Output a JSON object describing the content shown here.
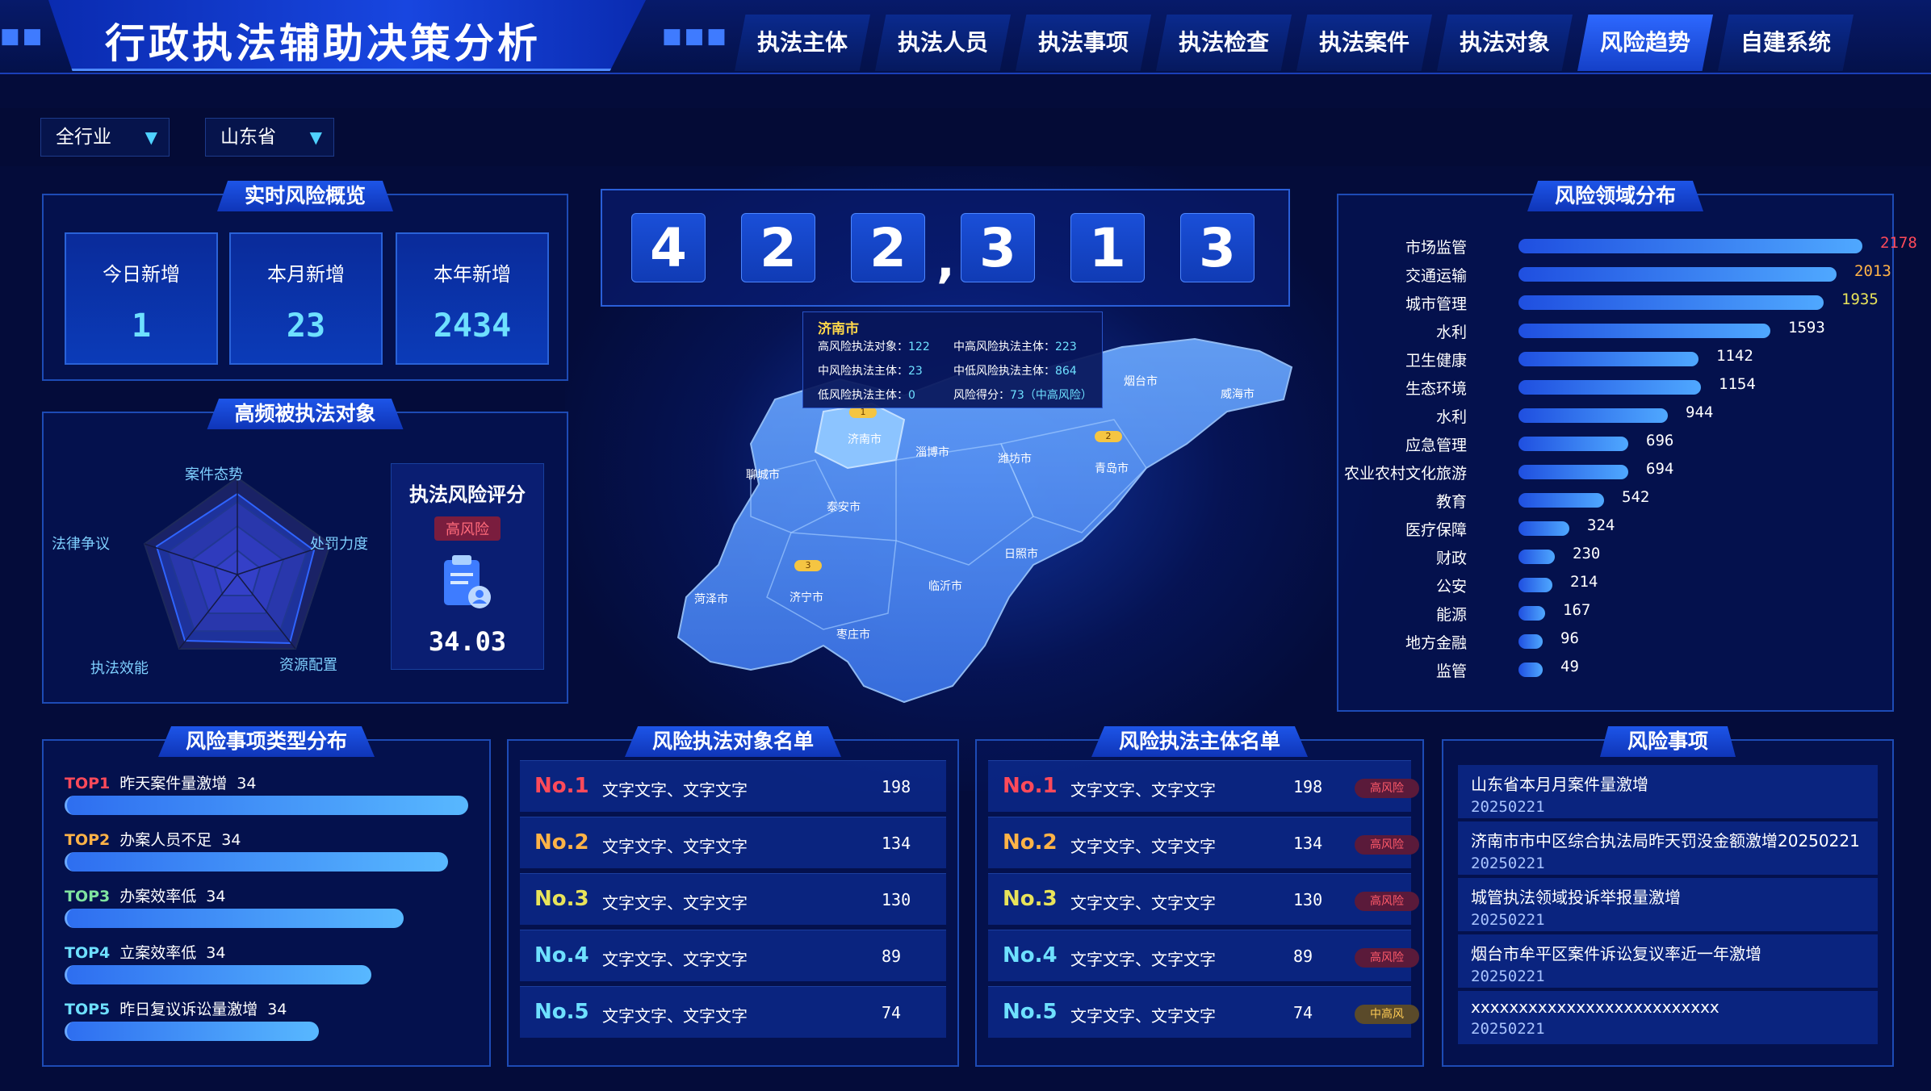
{
  "header": {
    "title": "行政执法辅助决策分析",
    "nav": [
      "执法主体",
      "执法人员",
      "执法事项",
      "执法检查",
      "执法案件",
      "执法对象",
      "风险趋势",
      "自建系统"
    ],
    "active_nav": "风险趋势"
  },
  "filters": {
    "industry": "全行业",
    "region": "山东省"
  },
  "overview": {
    "title": "实时风险概览",
    "stats": [
      {
        "label": "今日新增",
        "value": "1"
      },
      {
        "label": "本月新增",
        "value": "23"
      },
      {
        "label": "本年新增",
        "value": "2434"
      }
    ]
  },
  "radar": {
    "title": "高频被执法对象",
    "axes": [
      "案件态势",
      "处罚力度",
      "资源配置",
      "执法效能",
      "法律争议"
    ],
    "score_title": "执法风险评分",
    "score_level": "高风险",
    "score_value": "34.03"
  },
  "counter": {
    "digits": [
      "4",
      "2",
      "2",
      "3",
      "1",
      "3"
    ],
    "separator": ","
  },
  "map": {
    "tooltip": {
      "city": "济南市",
      "lines": [
        {
          "label": "高风险执法对象：",
          "value": "122"
        },
        {
          "label": "中高风险执法主体：",
          "value": "223"
        },
        {
          "label": "中风险执法主体：",
          "value": "23"
        },
        {
          "label": "中低风险执法主体：",
          "value": "864"
        },
        {
          "label": "低风险执法主体：",
          "value": "0"
        },
        {
          "label": "风险得分：",
          "value": "73（中高风险）"
        }
      ]
    },
    "cities": [
      "济南市",
      "淄博市",
      "潍坊市",
      "烟台市",
      "威海市",
      "青岛市",
      "聊城市",
      "泰安市",
      "日照市",
      "临沂市",
      "济宁市",
      "菏泽市",
      "枣庄市"
    ],
    "pins": [
      "1",
      "2",
      "3"
    ]
  },
  "risk_domain": {
    "title": "风险领域分布",
    "items": [
      {
        "label": "市场监管",
        "value": 2178,
        "color": "#ff4a5a"
      },
      {
        "label": "交通运输",
        "value": 2013,
        "color": "#ffb347"
      },
      {
        "label": "城市管理",
        "value": 1935,
        "color": "#e8e35a"
      },
      {
        "label": "水利",
        "value": 1593,
        "color": "#ffffff"
      },
      {
        "label": "卫生健康",
        "value": 1142,
        "color": "#ffffff"
      },
      {
        "label": "生态环境",
        "value": 1154,
        "color": "#ffffff"
      },
      {
        "label": "水利",
        "value": 944,
        "color": "#ffffff"
      },
      {
        "label": "应急管理",
        "value": 696,
        "color": "#ffffff"
      },
      {
        "label": "农业农村文化旅游",
        "value": 694,
        "color": "#ffffff"
      },
      {
        "label": "教育",
        "value": 542,
        "color": "#ffffff"
      },
      {
        "label": "医疗保障",
        "value": 324,
        "color": "#ffffff"
      },
      {
        "label": "财政",
        "value": 230,
        "color": "#ffffff"
      },
      {
        "label": "公安",
        "value": 214,
        "color": "#ffffff"
      },
      {
        "label": "能源",
        "value": 167,
        "color": "#ffffff"
      },
      {
        "label": "地方金融",
        "value": 96,
        "color": "#ffffff"
      },
      {
        "label": "监管",
        "value": 49,
        "color": "#ffffff"
      }
    ]
  },
  "risk_type": {
    "title": "风险事项类型分布",
    "items": [
      {
        "rank": "TOP1",
        "label": "昨天案件量激增",
        "value": "34",
        "color": "#ff4a5a",
        "level": 1.0
      },
      {
        "rank": "TOP2",
        "label": "办案人员不足",
        "value": "34",
        "color": "#ffb347",
        "level": 0.95
      },
      {
        "rank": "TOP3",
        "label": "办案效率低",
        "value": "34",
        "color": "#7fe3a0",
        "level": 0.84
      },
      {
        "rank": "TOP4",
        "label": "立案效率低",
        "value": "34",
        "color": "#6ee0ff",
        "level": 0.76
      },
      {
        "rank": "TOP5",
        "label": "昨日复议诉讼量激增",
        "value": "34",
        "color": "#6ee0ff",
        "level": 0.63
      }
    ]
  },
  "risk_objects": {
    "title": "风险执法对象名单",
    "rows": [
      {
        "no": "No.1",
        "name": "文字文字、文字文字",
        "count": "198",
        "color": "#ff4a5a"
      },
      {
        "no": "No.2",
        "name": "文字文字、文字文字",
        "count": "134",
        "color": "#ffb347"
      },
      {
        "no": "No.3",
        "name": "文字文字、文字文字",
        "count": "130",
        "color": "#e8e35a"
      },
      {
        "no": "No.4",
        "name": "文字文字、文字文字",
        "count": "89",
        "color": "#6ee0ff"
      },
      {
        "no": "No.5",
        "name": "文字文字、文字文字",
        "count": "74",
        "color": "#6ee0ff"
      }
    ]
  },
  "risk_subjects": {
    "title": "风险执法主体名单",
    "rows": [
      {
        "no": "No.1",
        "name": "文字文字、文字文字",
        "count": "198",
        "badge": "高风险",
        "color": "#ff4a5a"
      },
      {
        "no": "No.2",
        "name": "文字文字、文字文字",
        "count": "134",
        "badge": "高风险",
        "color": "#ffb347"
      },
      {
        "no": "No.3",
        "name": "文字文字、文字文字",
        "count": "130",
        "badge": "高风险",
        "color": "#e8e35a"
      },
      {
        "no": "No.4",
        "name": "文字文字、文字文字",
        "count": "89",
        "badge": "高风险",
        "color": "#6ee0ff"
      },
      {
        "no": "No.5",
        "name": "文字文字、文字文字",
        "count": "74",
        "badge": "中高风",
        "color": "#6ee0ff"
      }
    ]
  },
  "risk_events": {
    "title": "风险事项",
    "items": [
      {
        "text": "山东省本月月案件量激增",
        "date": "20250221"
      },
      {
        "text": "济南市市中区综合执法局昨天罚没金额激增20250221",
        "date": "20250221"
      },
      {
        "text": "城管执法领域投诉举报量激增",
        "date": "20250221"
      },
      {
        "text": "烟台市牟平区案件诉讼复议率近一年激增",
        "date": "20250221"
      },
      {
        "text": "xxxxxxxxxxxxxxxxxxxxxxxxxx",
        "date": "20250221"
      }
    ]
  }
}
